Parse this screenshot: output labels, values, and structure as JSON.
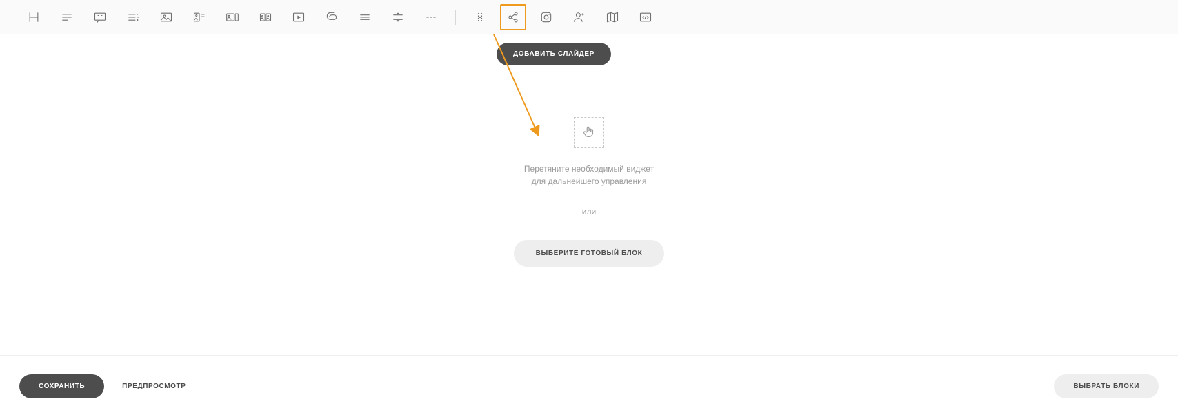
{
  "toolbar": {
    "items": [
      {
        "name": "heading-icon"
      },
      {
        "name": "text-icon"
      },
      {
        "name": "quote-icon"
      },
      {
        "name": "list-icon"
      },
      {
        "name": "image-icon"
      },
      {
        "name": "image-text-icon"
      },
      {
        "name": "image-pair-icon"
      },
      {
        "name": "gallery-icon"
      },
      {
        "name": "video-icon"
      },
      {
        "name": "attachment-icon"
      },
      {
        "name": "divider-icon"
      },
      {
        "name": "spacer-icon"
      },
      {
        "name": "dash-icon"
      },
      {
        "name": "separator-dot-icon"
      },
      {
        "name": "share-icon",
        "selected": true
      },
      {
        "name": "instagram-icon"
      },
      {
        "name": "person-add-icon"
      },
      {
        "name": "map-icon"
      },
      {
        "name": "code-icon"
      }
    ]
  },
  "popover": {
    "label": "ДОБАВИТЬ СЛАЙДЕР"
  },
  "dropzone": {
    "hint_line1": "Перетяните необходимый виджет",
    "hint_line2": "для дальнейшего управления",
    "or": "или",
    "ready_block": "ВЫБЕРИТЕ ГОТОВЫЙ БЛОК"
  },
  "footer": {
    "save": "СОХРАНИТЬ",
    "preview": "ПРЕДПРОСМОТР",
    "choose_blocks": "ВЫБРАТЬ БЛОКИ"
  },
  "annotation": {
    "color": "#ee9a1f"
  }
}
